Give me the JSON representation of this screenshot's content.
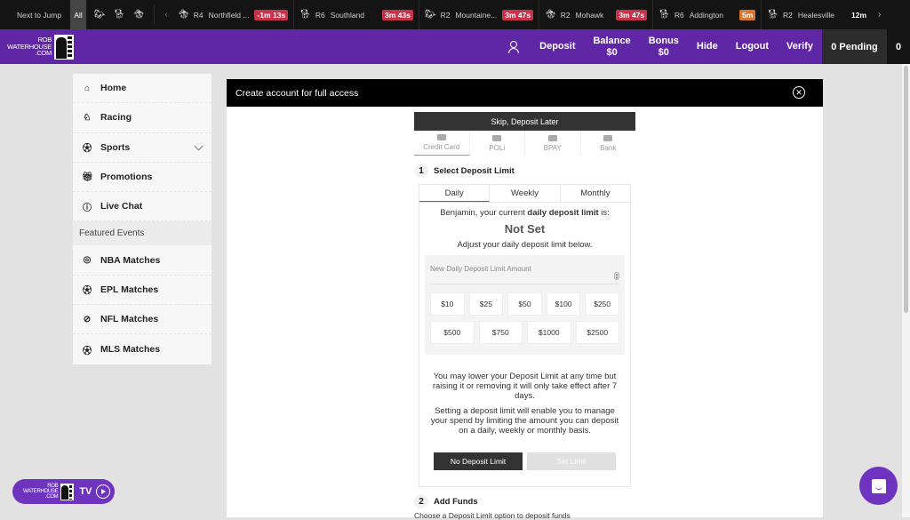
{
  "ticker": {
    "next_to_jump": "Next to Jump",
    "all_label": "All",
    "type_filters": [
      "thoroughbred-icon",
      "greyhound-icon",
      "harness-icon"
    ],
    "races": [
      {
        "icon": "harness-icon",
        "race": "R4",
        "venue": "Northfield ...",
        "time": "-1m 13s",
        "status": "red"
      },
      {
        "icon": "greyhound-icon",
        "race": "R6",
        "venue": "Southland",
        "time": "3m 43s",
        "status": "red"
      },
      {
        "icon": "thoroughbred-icon",
        "race": "R2",
        "venue": "Mountaine...",
        "time": "3m 47s",
        "status": "red"
      },
      {
        "icon": "harness-icon",
        "race": "R2",
        "venue": "Mohawk",
        "time": "3m 47s",
        "status": "red"
      },
      {
        "icon": "greyhound-icon",
        "race": "R6",
        "venue": "Addington",
        "time": "5m",
        "status": "orange"
      },
      {
        "icon": "greyhound-icon",
        "race": "R2",
        "venue": "Healesville",
        "time": "12m",
        "status": "plain"
      }
    ]
  },
  "header": {
    "logo_lines": [
      "ROB",
      "WATERHOUSE",
      ".COM"
    ],
    "deposit": "Deposit",
    "balance_label": "Balance",
    "balance_value": "$0",
    "bonus_label": "Bonus",
    "bonus_value": "$0",
    "hide": "Hide",
    "logout": "Logout",
    "verify": "Verify",
    "pending": "0 Pending",
    "count": "0"
  },
  "sidebar": {
    "items": [
      {
        "label": "Home",
        "icon": "home-icon"
      },
      {
        "label": "Racing",
        "icon": "racing-icon"
      },
      {
        "label": "Sports",
        "icon": "soccer-ball-icon"
      },
      {
        "label": "Promotions",
        "icon": "gift-icon"
      },
      {
        "label": "Live Chat",
        "icon": "help-icon"
      }
    ],
    "section_label": "Featured Events",
    "featured": [
      {
        "label": "NBA Matches",
        "icon": "basketball-icon"
      },
      {
        "label": "EPL Matches",
        "icon": "soccer-ball-icon"
      },
      {
        "label": "NFL Matches",
        "icon": "football-icon"
      },
      {
        "label": "MLS Matches",
        "icon": "soccer-ball-icon"
      }
    ]
  },
  "main": {
    "banner": "Create account for full access",
    "skip": "Skip, Deposit Later",
    "methods": [
      "Credit Card",
      "POLi",
      "BPAY",
      "Bank"
    ],
    "step1_num": "1",
    "step1_title": "Select Deposit Limit",
    "tabs": [
      "Daily",
      "Weekly",
      "Monthly"
    ],
    "current_prefix": "Benjamin, your current ",
    "current_bold": "daily deposit limit",
    "current_suffix": " is:",
    "current_value": "Not Set",
    "adjust": "Adjust your daily deposit limit below.",
    "amount_placeholder": "New Daily Deposit Limit Amount",
    "chips_row1": [
      "$10",
      "$25",
      "$50",
      "$100",
      "$250"
    ],
    "chips_row2": [
      "$500",
      "$750",
      "$1000",
      "$2500"
    ],
    "info1": "You may lower your Deposit Limit at any time but raising it or removing it will only take effect after 7 days.",
    "info2": "Setting a deposit limit will enable you to manage your spend by limiting the amount you can deposit on a daily, weekly or monthly basis.",
    "no_limit_btn": "No Deposit Limit",
    "set_limit_btn": "Set Limit",
    "step2_num": "2",
    "step2_title": "Add Funds",
    "step2_desc": "Choose a Deposit Limit option to deposit funds"
  },
  "tv": {
    "logo_lines": [
      "ROB",
      "WATERHOUSE",
      ".COM"
    ],
    "label": "TV"
  }
}
